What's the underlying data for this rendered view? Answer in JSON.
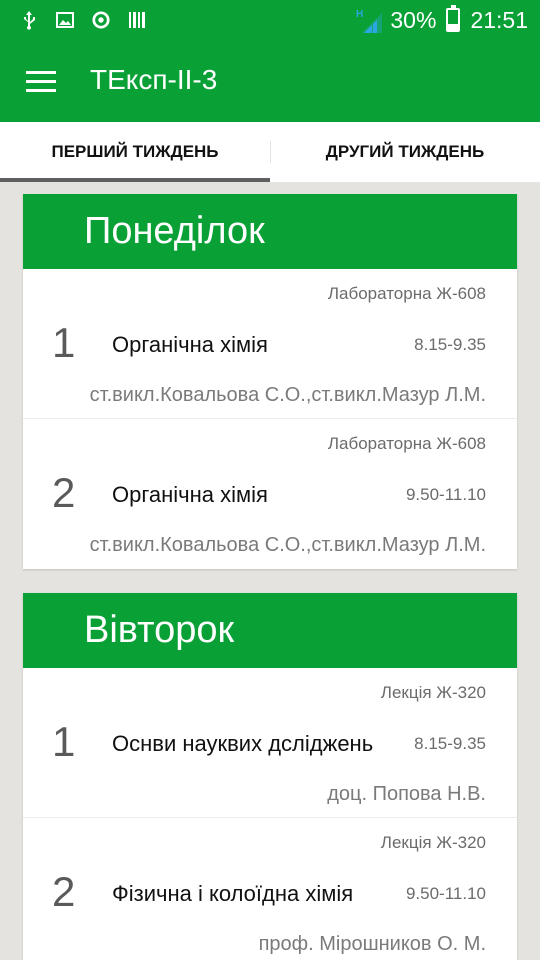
{
  "status_bar": {
    "icons": [
      "usb-icon",
      "image-icon",
      "sync-icon",
      "barcode-icon"
    ],
    "network_type": "H",
    "battery": "30%",
    "battery_level": 0.3,
    "time": "21:51"
  },
  "app_bar": {
    "title": "ТЕксп-ІІ-3",
    "menu_icon": "hamburger-menu-icon"
  },
  "tabs": [
    {
      "label": "ПЕРШИЙ ТИЖДЕНЬ",
      "active": true
    },
    {
      "label": "ДРУГИЙ ТИЖДЕНЬ",
      "active": false
    }
  ],
  "days": [
    {
      "name": "Понеділок",
      "lessons": [
        {
          "type": "Лабораторна Ж-608",
          "number": "1",
          "name": "Органічна хімія",
          "time": "8.15-9.35",
          "teacher": "ст.викл.Ковальова С.О.,ст.викл.Мазур Л.М."
        },
        {
          "type": "Лабораторна Ж-608",
          "number": "2",
          "name": "Органічна хімія",
          "time": "9.50-11.10",
          "teacher": "ст.викл.Ковальова С.О.,ст.викл.Мазур Л.М."
        }
      ]
    },
    {
      "name": "Вівторок",
      "lessons": [
        {
          "type": "Лекція Ж-320",
          "number": "1",
          "name": "Оснви науквих дсліджень",
          "time": "8.15-9.35",
          "teacher": "доц. Попова Н.В."
        },
        {
          "type": "Лекція Ж-320",
          "number": "2",
          "name": "Фізична і колоїдна  хімія",
          "time": "9.50-11.10",
          "teacher": "проф. Мірошников О. М."
        }
      ]
    }
  ],
  "colors": {
    "primary": "#09a136",
    "background": "#e5e3df",
    "tab_indicator": "#5f5f5f"
  }
}
